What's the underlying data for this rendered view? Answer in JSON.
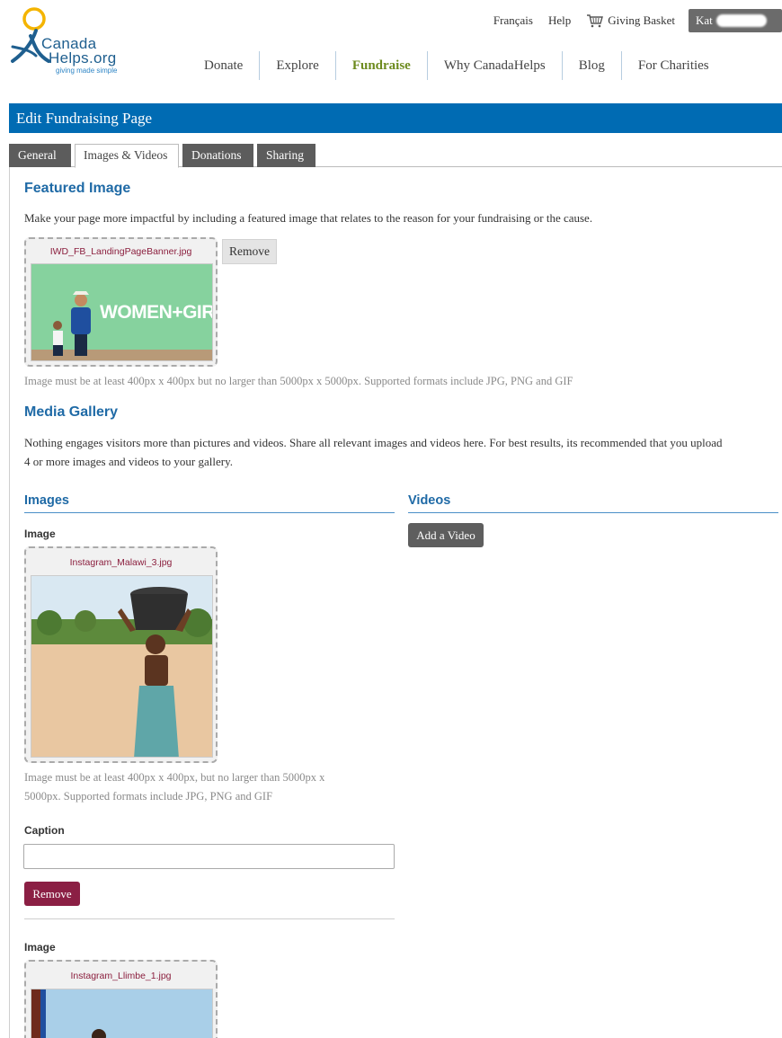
{
  "brand": {
    "line1": "Canada",
    "line2": "Helps.org",
    "tagline": "giving made simple",
    "colors": {
      "blue": "#1f5f8f",
      "yellow": "#f4b400",
      "light_blue": "#2f86c6"
    }
  },
  "utility_nav": {
    "language": "Français",
    "help": "Help",
    "basket": "Giving Basket",
    "basket_icon": "cart-icon",
    "account_name": "Kat"
  },
  "main_nav": {
    "items": [
      {
        "label": "Donate"
      },
      {
        "label": "Explore"
      },
      {
        "label": "Fundraise"
      },
      {
        "label": "Why CanadaHelps"
      },
      {
        "label": "Blog"
      },
      {
        "label": "For Charities"
      }
    ],
    "active": "Fundraise"
  },
  "title_bar": {
    "text": "Edit Fundraising Page",
    "color": "#006bb3"
  },
  "tabs": [
    {
      "label": "General"
    },
    {
      "label": "Images & Videos"
    },
    {
      "label": "Donations"
    },
    {
      "label": "Sharing"
    }
  ],
  "active_tab": "Images & Videos",
  "featured": {
    "heading": "Featured Image",
    "description": "Make your page more impactful by including a featured image that relates to the reason for your fundraising or the cause.",
    "filename": "IWD_FB_LandingPageBanner.jpg",
    "image_text": "WOMEN+GIRLS",
    "remove_label": "Remove",
    "hint": "Image must be at least 400px x 400px but no larger than 5000px x 5000px. Supported formats include JPG, PNG and GIF"
  },
  "gallery": {
    "heading": "Media Gallery",
    "description_line1": "Nothing engages visitors more than pictures and videos. Share all relevant images and videos here. For best results, its recommended that you upload",
    "description_line2": "4 or more images and videos to your gallery.",
    "images_heading": "Images",
    "videos_heading": "Videos",
    "add_video_label": "Add a Video",
    "items": [
      {
        "label": "Image",
        "filename": "Instagram_Malawi_3.jpg",
        "hint_line1": "Image must be at least 400px x 400px, but no larger than 5000px x",
        "hint_line2": "5000px. Supported formats include JPG, PNG and GIF",
        "caption_label": "Caption",
        "caption_value": "",
        "remove_label": "Remove"
      },
      {
        "label": "Image",
        "filename": "Instagram_Llimbe_1.jpg"
      }
    ]
  },
  "accent_colors": {
    "heading_blue": "#1f6aa6",
    "remove_red": "#8b1f44",
    "fundraise_green": "#6d8b1e"
  }
}
